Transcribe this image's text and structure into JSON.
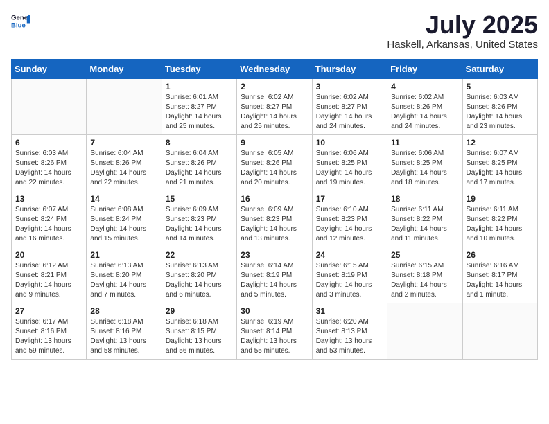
{
  "header": {
    "logo_general": "General",
    "logo_blue": "Blue",
    "month_title": "July 2025",
    "location": "Haskell, Arkansas, United States"
  },
  "weekdays": [
    "Sunday",
    "Monday",
    "Tuesday",
    "Wednesday",
    "Thursday",
    "Friday",
    "Saturday"
  ],
  "weeks": [
    [
      {
        "day": "",
        "sunrise": "",
        "sunset": "",
        "daylight": ""
      },
      {
        "day": "",
        "sunrise": "",
        "sunset": "",
        "daylight": ""
      },
      {
        "day": "1",
        "sunrise": "Sunrise: 6:01 AM",
        "sunset": "Sunset: 8:27 PM",
        "daylight": "Daylight: 14 hours and 25 minutes."
      },
      {
        "day": "2",
        "sunrise": "Sunrise: 6:02 AM",
        "sunset": "Sunset: 8:27 PM",
        "daylight": "Daylight: 14 hours and 25 minutes."
      },
      {
        "day": "3",
        "sunrise": "Sunrise: 6:02 AM",
        "sunset": "Sunset: 8:27 PM",
        "daylight": "Daylight: 14 hours and 24 minutes."
      },
      {
        "day": "4",
        "sunrise": "Sunrise: 6:02 AM",
        "sunset": "Sunset: 8:26 PM",
        "daylight": "Daylight: 14 hours and 24 minutes."
      },
      {
        "day": "5",
        "sunrise": "Sunrise: 6:03 AM",
        "sunset": "Sunset: 8:26 PM",
        "daylight": "Daylight: 14 hours and 23 minutes."
      }
    ],
    [
      {
        "day": "6",
        "sunrise": "Sunrise: 6:03 AM",
        "sunset": "Sunset: 8:26 PM",
        "daylight": "Daylight: 14 hours and 22 minutes."
      },
      {
        "day": "7",
        "sunrise": "Sunrise: 6:04 AM",
        "sunset": "Sunset: 8:26 PM",
        "daylight": "Daylight: 14 hours and 22 minutes."
      },
      {
        "day": "8",
        "sunrise": "Sunrise: 6:04 AM",
        "sunset": "Sunset: 8:26 PM",
        "daylight": "Daylight: 14 hours and 21 minutes."
      },
      {
        "day": "9",
        "sunrise": "Sunrise: 6:05 AM",
        "sunset": "Sunset: 8:26 PM",
        "daylight": "Daylight: 14 hours and 20 minutes."
      },
      {
        "day": "10",
        "sunrise": "Sunrise: 6:06 AM",
        "sunset": "Sunset: 8:25 PM",
        "daylight": "Daylight: 14 hours and 19 minutes."
      },
      {
        "day": "11",
        "sunrise": "Sunrise: 6:06 AM",
        "sunset": "Sunset: 8:25 PM",
        "daylight": "Daylight: 14 hours and 18 minutes."
      },
      {
        "day": "12",
        "sunrise": "Sunrise: 6:07 AM",
        "sunset": "Sunset: 8:25 PM",
        "daylight": "Daylight: 14 hours and 17 minutes."
      }
    ],
    [
      {
        "day": "13",
        "sunrise": "Sunrise: 6:07 AM",
        "sunset": "Sunset: 8:24 PM",
        "daylight": "Daylight: 14 hours and 16 minutes."
      },
      {
        "day": "14",
        "sunrise": "Sunrise: 6:08 AM",
        "sunset": "Sunset: 8:24 PM",
        "daylight": "Daylight: 14 hours and 15 minutes."
      },
      {
        "day": "15",
        "sunrise": "Sunrise: 6:09 AM",
        "sunset": "Sunset: 8:23 PM",
        "daylight": "Daylight: 14 hours and 14 minutes."
      },
      {
        "day": "16",
        "sunrise": "Sunrise: 6:09 AM",
        "sunset": "Sunset: 8:23 PM",
        "daylight": "Daylight: 14 hours and 13 minutes."
      },
      {
        "day": "17",
        "sunrise": "Sunrise: 6:10 AM",
        "sunset": "Sunset: 8:23 PM",
        "daylight": "Daylight: 14 hours and 12 minutes."
      },
      {
        "day": "18",
        "sunrise": "Sunrise: 6:11 AM",
        "sunset": "Sunset: 8:22 PM",
        "daylight": "Daylight: 14 hours and 11 minutes."
      },
      {
        "day": "19",
        "sunrise": "Sunrise: 6:11 AM",
        "sunset": "Sunset: 8:22 PM",
        "daylight": "Daylight: 14 hours and 10 minutes."
      }
    ],
    [
      {
        "day": "20",
        "sunrise": "Sunrise: 6:12 AM",
        "sunset": "Sunset: 8:21 PM",
        "daylight": "Daylight: 14 hours and 9 minutes."
      },
      {
        "day": "21",
        "sunrise": "Sunrise: 6:13 AM",
        "sunset": "Sunset: 8:20 PM",
        "daylight": "Daylight: 14 hours and 7 minutes."
      },
      {
        "day": "22",
        "sunrise": "Sunrise: 6:13 AM",
        "sunset": "Sunset: 8:20 PM",
        "daylight": "Daylight: 14 hours and 6 minutes."
      },
      {
        "day": "23",
        "sunrise": "Sunrise: 6:14 AM",
        "sunset": "Sunset: 8:19 PM",
        "daylight": "Daylight: 14 hours and 5 minutes."
      },
      {
        "day": "24",
        "sunrise": "Sunrise: 6:15 AM",
        "sunset": "Sunset: 8:19 PM",
        "daylight": "Daylight: 14 hours and 3 minutes."
      },
      {
        "day": "25",
        "sunrise": "Sunrise: 6:15 AM",
        "sunset": "Sunset: 8:18 PM",
        "daylight": "Daylight: 14 hours and 2 minutes."
      },
      {
        "day": "26",
        "sunrise": "Sunrise: 6:16 AM",
        "sunset": "Sunset: 8:17 PM",
        "daylight": "Daylight: 14 hours and 1 minute."
      }
    ],
    [
      {
        "day": "27",
        "sunrise": "Sunrise: 6:17 AM",
        "sunset": "Sunset: 8:16 PM",
        "daylight": "Daylight: 13 hours and 59 minutes."
      },
      {
        "day": "28",
        "sunrise": "Sunrise: 6:18 AM",
        "sunset": "Sunset: 8:16 PM",
        "daylight": "Daylight: 13 hours and 58 minutes."
      },
      {
        "day": "29",
        "sunrise": "Sunrise: 6:18 AM",
        "sunset": "Sunset: 8:15 PM",
        "daylight": "Daylight: 13 hours and 56 minutes."
      },
      {
        "day": "30",
        "sunrise": "Sunrise: 6:19 AM",
        "sunset": "Sunset: 8:14 PM",
        "daylight": "Daylight: 13 hours and 55 minutes."
      },
      {
        "day": "31",
        "sunrise": "Sunrise: 6:20 AM",
        "sunset": "Sunset: 8:13 PM",
        "daylight": "Daylight: 13 hours and 53 minutes."
      },
      {
        "day": "",
        "sunrise": "",
        "sunset": "",
        "daylight": ""
      },
      {
        "day": "",
        "sunrise": "",
        "sunset": "",
        "daylight": ""
      }
    ]
  ]
}
